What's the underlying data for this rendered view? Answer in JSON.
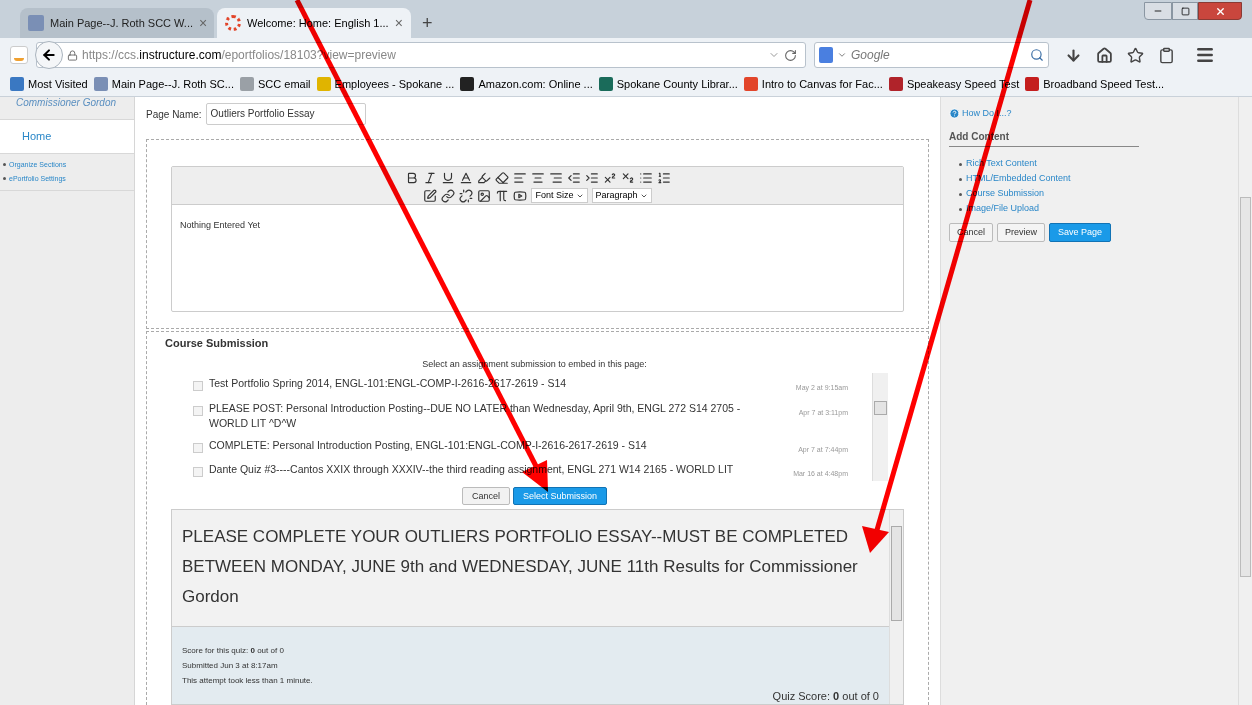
{
  "browser": {
    "tabs": [
      {
        "title": "Main Page--J. Roth SCC W...",
        "selected": false,
        "close": "×"
      },
      {
        "title": "Welcome: Home: English 1...",
        "selected": true,
        "close": "×"
      }
    ],
    "new_tab": "+",
    "url": {
      "prefix": "https://ccs.",
      "host": "instructure.com",
      "path": "/eportfolios/18103?view=preview"
    },
    "search_placeholder": "Google",
    "bookmarks": [
      {
        "label": "Most Visited",
        "color": "#3a78c2"
      },
      {
        "label": "Main Page--J. Roth SC...",
        "color": "#7a8fb5"
      },
      {
        "label": "SCC email",
        "color": "#9aa0a6"
      },
      {
        "label": "Employees - Spokane ...",
        "color": "#e0b400"
      },
      {
        "label": "Amazon.com: Online ...",
        "color": "#222222"
      },
      {
        "label": "Spokane County Librar...",
        "color": "#1a6b5a"
      },
      {
        "label": "Intro to Canvas for Fac...",
        "color": "#e2452a"
      },
      {
        "label": "Speakeasy Speed Test",
        "color": "#b0232a"
      },
      {
        "label": "Broadband Speed Test...",
        "color": "#c41e1e"
      }
    ]
  },
  "sidebar": {
    "user": "Commissioner Gordon",
    "items": [
      {
        "label": "Home",
        "selected": true
      }
    ],
    "links": [
      "Organize Sections",
      "ePortfolio Settings"
    ]
  },
  "page_name": {
    "label": "Page Name:",
    "value": "Outliers Portfolio Essay"
  },
  "editor": {
    "font_size": "Font Size",
    "paragraph": "Paragraph",
    "content": "Nothing Entered Yet"
  },
  "course_submission": {
    "title": "Course Submission",
    "instructions": "Select an assignment submission to embed in this page:",
    "items": [
      {
        "title": "Test Portfolio Spring 2014, ENGL-101:ENGL-COMP-I-2616-2617-2619 - S14",
        "date": "May 2 at 9:15am",
        "checked": false
      },
      {
        "title": "PLEASE POST: Personal Introduction Posting--DUE NO LATER than Wednesday, April 9th, ENGL 272 S14 2705 - WORLD LIT ^D^W",
        "date": "Apr 7 at 3:11pm",
        "checked": false
      },
      {
        "title": "COMPLETE: Personal Introduction Posting, ENGL-101:ENGL-COMP-I-2616-2617-2619 - S14",
        "date": "Apr 7 at 7:44pm",
        "checked": false
      },
      {
        "title": "Dante Quiz #3----Cantos XXIX through XXXIV--the third reading assignment, ENGL 271 W14 2165 - WORLD LIT",
        "date": "Mar 16 at 4:48pm",
        "checked": false
      }
    ],
    "cancel": "Cancel",
    "select": "Select Submission",
    "embed": {
      "heading": "PLEASE COMPLETE YOUR OUTLIERS PORTFOLIO ESSAY--MUST BE COMPLETED BETWEEN MONDAY, JUNE 9th and WEDNESDAY, JUNE 11th Results for Commissioner Gordon",
      "score": "Score for this quiz: **0** out of 0",
      "submitted": "Submitted Jun 3 at 8:17am",
      "duration": "This attempt took less than 1 minute.",
      "quiz_score": "Quiz Score: **0** out of 0"
    }
  },
  "right_panel": {
    "help": "How Do I...?",
    "title": "Add Content",
    "links": [
      "Rich Text Content",
      "HTML/Embedded Content",
      "Course Submission",
      "Image/File Upload"
    ],
    "cancel": "Cancel",
    "preview": "Preview",
    "save": "Save Page"
  }
}
